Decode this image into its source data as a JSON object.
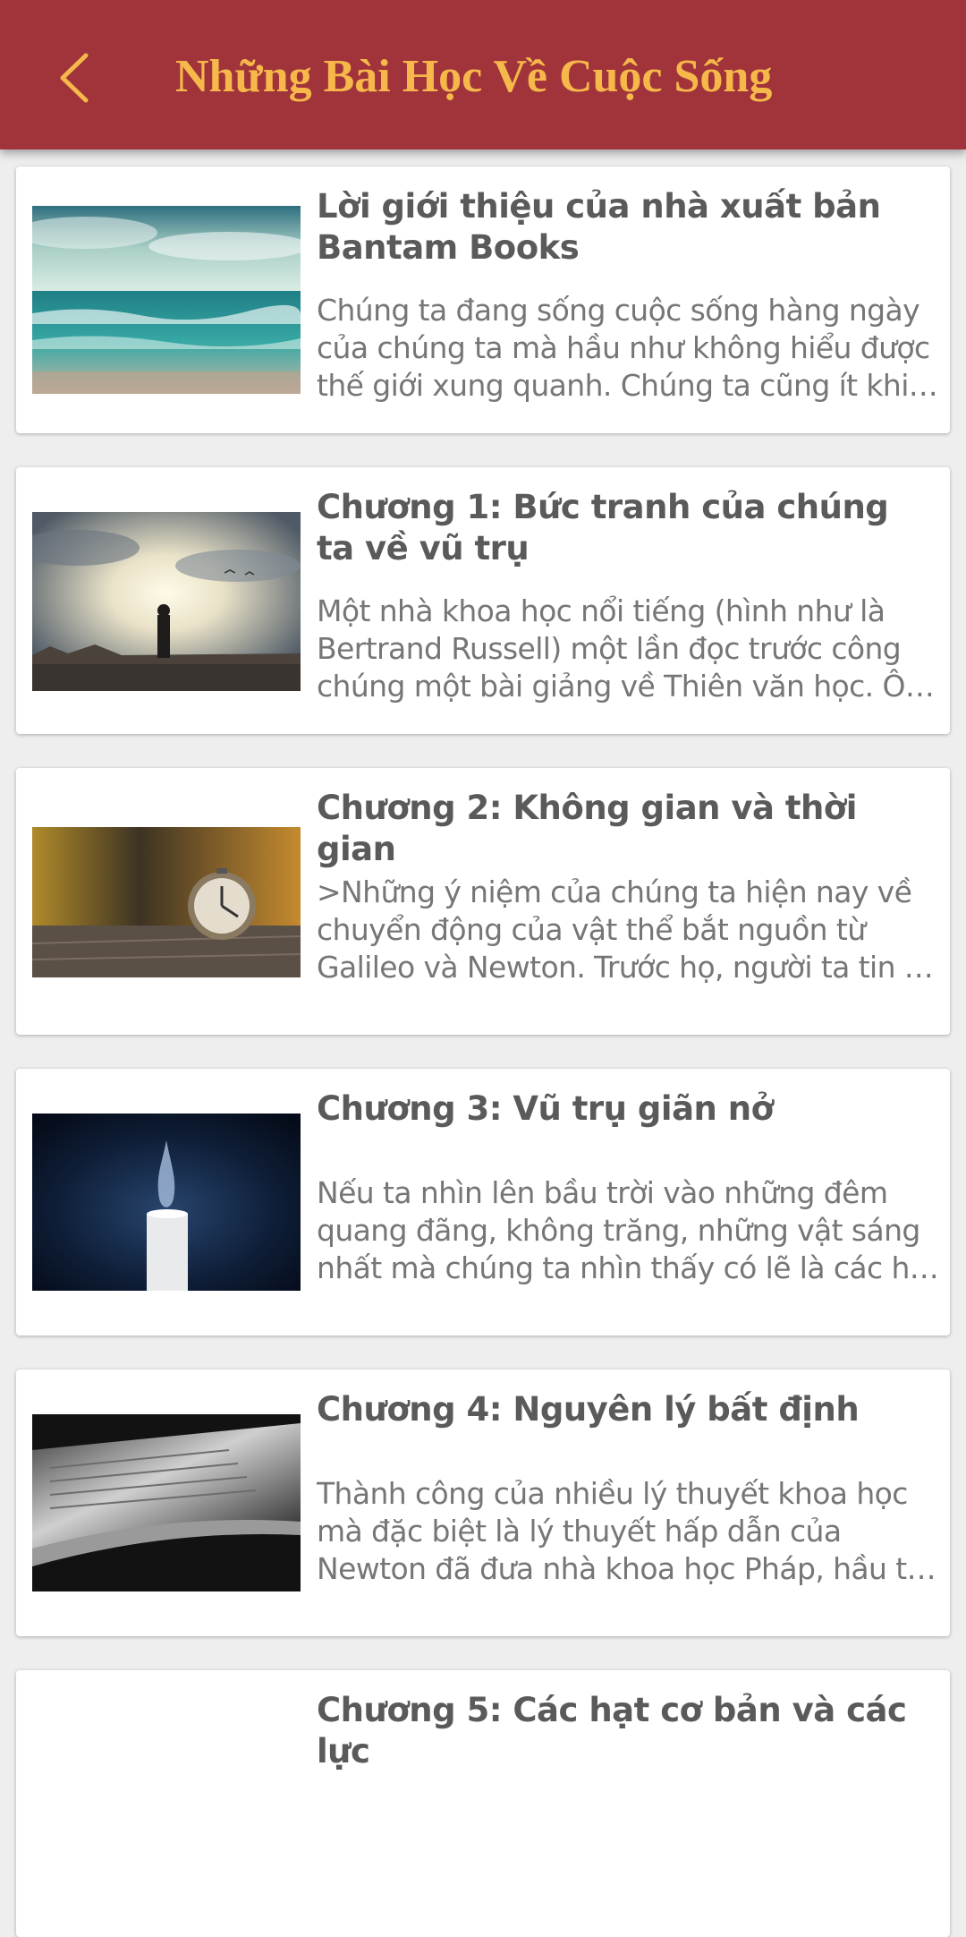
{
  "header": {
    "title": "Những Bài Học Về Cuộc Sống",
    "back_icon": "chevron-left-icon",
    "background_color": "#a0343a",
    "title_color": "#f7b84b"
  },
  "chapters": [
    {
      "title": "Lời giới thiệu của nhà xuất bản Bantam Books",
      "description": "Chúng ta đang sống cuộc sống hàng ngày của chúng ta mà hầu như không hiểu được thế giới xung quanh. Chúng ta cũng ít khi …",
      "image": "ocean-waves-image"
    },
    {
      "title": "Chương 1: Bức tranh của chúng ta về vũ trụ",
      "description": "Một nhà khoa học nổi tiếng (hình như là Bertrand Russell) một lần đọc trước công chúng một bài giảng về Thiên văn học. Ô…",
      "image": "silhouette-sky-image"
    },
    {
      "title": "Chương 2: Không gian và thời gian",
      "description": ">Những ý niệm của chúng ta hiện nay về chuyển động của vật thể bắt nguồn từ Galileo và Newton. Trước họ, người ta tin …",
      "image": "alarm-clock-image"
    },
    {
      "title": "Chương 3: Vũ trụ giãn nở",
      "description": "Nếu ta nhìn lên bầu trời vào những đêm quang đãng, không trăng, những vật sáng nhất mà chúng ta nhìn thấy có lẽ là các h…",
      "image": "candle-flame-image"
    },
    {
      "title": "Chương 4: Nguyên lý bất định",
      "description": "Thành công của nhiều lý thuyết khoa học mà đặc biệt là lý thuyết hấp dẫn của Newton đã đưa nhà khoa học Pháp, hầu t…",
      "image": "open-book-image"
    },
    {
      "title": "Chương 5: Các hạt cơ bản và các lực",
      "description": "",
      "image": "chapter-5-image"
    }
  ]
}
